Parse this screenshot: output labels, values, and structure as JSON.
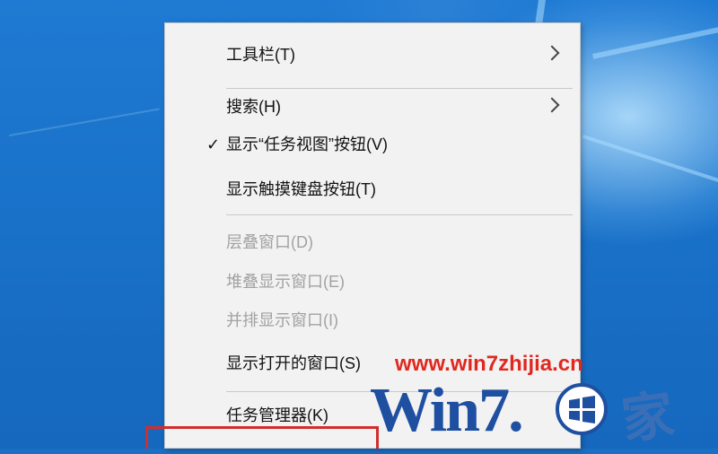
{
  "context_menu": {
    "items": [
      {
        "label": "工具栏(T)",
        "has_submenu": true,
        "disabled": false,
        "checked": false
      },
      {
        "label": "搜索(H)",
        "has_submenu": true,
        "disabled": false,
        "checked": false
      },
      {
        "label": "显示“任务视图”按钮(V)",
        "has_submenu": false,
        "disabled": false,
        "checked": true
      },
      {
        "label": "显示触摸键盘按钮(T)",
        "has_submenu": false,
        "disabled": false,
        "checked": false
      },
      {
        "label": "层叠窗口(D)",
        "has_submenu": false,
        "disabled": true,
        "checked": false
      },
      {
        "label": "堆叠显示窗口(E)",
        "has_submenu": false,
        "disabled": true,
        "checked": false
      },
      {
        "label": "并排显示窗口(I)",
        "has_submenu": false,
        "disabled": true,
        "checked": false
      },
      {
        "label": "显示打开的窗口(S)",
        "has_submenu": false,
        "disabled": false,
        "checked": false
      },
      {
        "label": "任务管理器(K)",
        "has_submenu": false,
        "disabled": false,
        "checked": false
      }
    ]
  },
  "watermark": {
    "url": "www.win7zhijia.cn",
    "brand": "Win7.",
    "brand_char": "家"
  },
  "colors": {
    "menu_background": "#f2f2f2",
    "disabled_text": "#a2a2a2",
    "highlight_box": "#d32d2d",
    "watermark_url": "#e0281f",
    "watermark_brand": "#1e4fa0"
  }
}
